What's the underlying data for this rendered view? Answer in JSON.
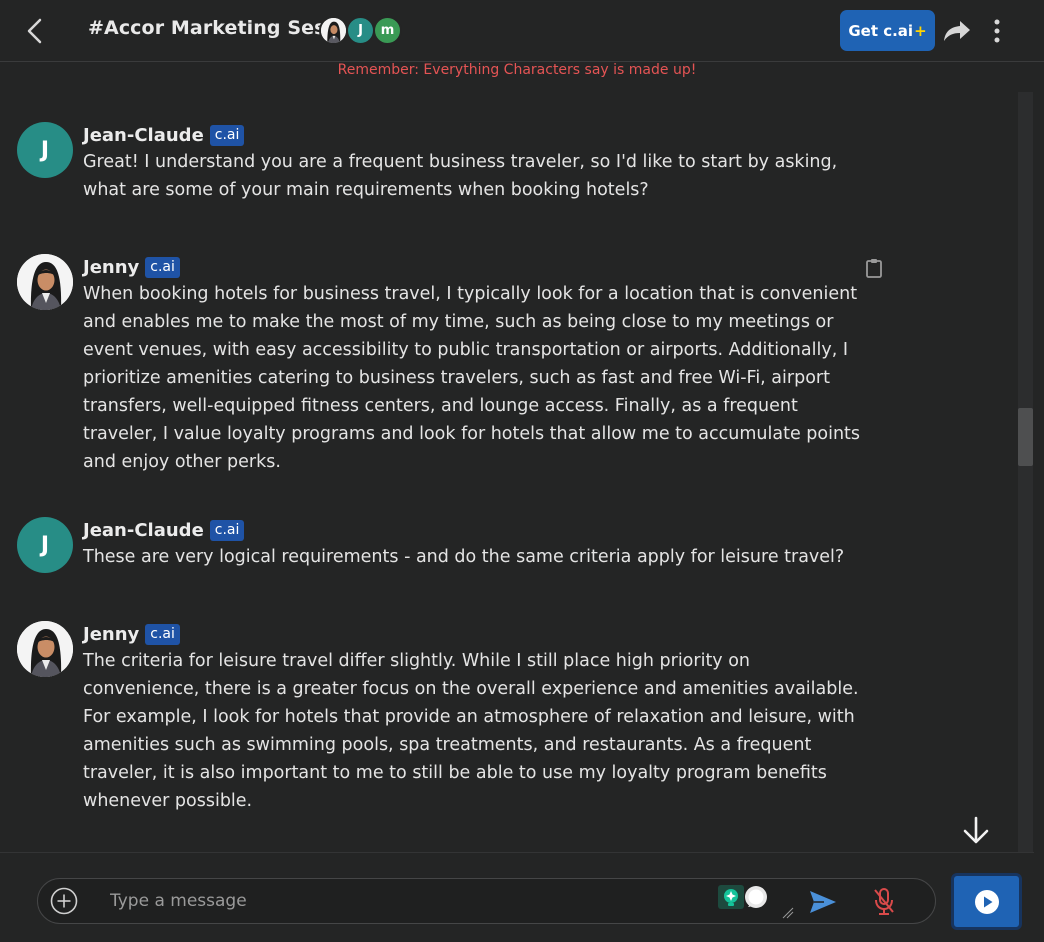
{
  "header": {
    "title": "#Accor Marketing Sesh",
    "members": [
      {
        "type": "photo",
        "name": "Jenny"
      },
      {
        "type": "letter",
        "letter": "J",
        "color": "#278d86"
      },
      {
        "type": "letter",
        "letter": "m",
        "color": "#3a9a55"
      }
    ],
    "get_button": "Get c.ai",
    "get_button_plus": "+",
    "disclaimer": "Remember: Everything Characters say is made up!"
  },
  "messages": [
    {
      "author": "Jean-Claude",
      "avatar_letter": "J",
      "badge": "c.ai",
      "text": "Great! I understand you are a frequent business traveler, so I'd like to start by asking,\nwhat are some of your main requirements when booking hotels?"
    },
    {
      "author": "Jenny",
      "badge": "c.ai",
      "text": "When booking hotels for business travel, I typically look for a location that is convenient\nand enables me to make the most of my time, such as being close to my meetings or\nevent venues, with easy accessibility to public transportation or airports. Additionally, I\nprioritize amenities catering to business travelers, such as fast and free Wi-Fi, airport\ntransfers, well-equipped fitness centers, and lounge access. Finally, as a frequent\ntraveler, I value loyalty programs and look for hotels that allow me to accumulate points\nand enjoy other perks."
    },
    {
      "author": "Jean-Claude",
      "avatar_letter": "J",
      "badge": "c.ai",
      "text": "These are very logical requirements - and do the same criteria apply for leisure travel?"
    },
    {
      "author": "Jenny",
      "badge": "c.ai",
      "text": "The criteria for leisure travel differ slightly. While I still place high priority on\nconvenience, there is a greater focus on the overall experience and amenities available.\nFor example, I look for hotels that provide an atmosphere of relaxation and leisure, with\namenities such as swimming pools, spa treatments, and restaurants. As a frequent\ntraveler, it is also important to me to still be able to use my loyalty program benefits\nwhenever possible."
    }
  ],
  "composer": {
    "placeholder": "Type a message"
  },
  "colors": {
    "accent": "#1f63b4",
    "avatar_teal": "#278d86",
    "disclaimer_red": "#e45454",
    "background": "#242525"
  }
}
